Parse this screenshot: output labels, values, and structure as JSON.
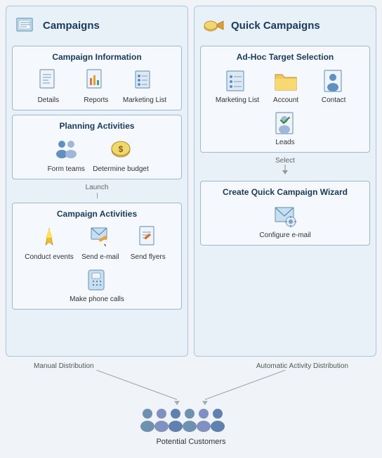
{
  "leftColumn": {
    "title": "Campaigns",
    "campaignInfo": {
      "title": "Campaign Information",
      "items": [
        {
          "label": "Details",
          "icon": "document"
        },
        {
          "label": "Reports",
          "icon": "report"
        },
        {
          "label": "Marketing List",
          "icon": "list"
        }
      ]
    },
    "planningActivities": {
      "title": "Planning Activities",
      "items": [
        {
          "label": "Form teams",
          "icon": "teams"
        },
        {
          "label": "Determine budget",
          "icon": "budget"
        }
      ]
    },
    "launchLabel": "Launch",
    "campaignActivities": {
      "title": "Campaign Activities",
      "items": [
        {
          "label": "Conduct events",
          "icon": "events"
        },
        {
          "label": "Send e-mail",
          "icon": "email"
        },
        {
          "label": "Send flyers",
          "icon": "flyers"
        },
        {
          "label": "Make phone calls",
          "icon": "phone"
        }
      ]
    }
  },
  "rightColumn": {
    "title": "Quick Campaigns",
    "adHocTarget": {
      "title": "Ad-Hoc Target Selection",
      "items": [
        {
          "label": "Marketing List",
          "icon": "mktlist"
        },
        {
          "label": "Account",
          "icon": "account"
        },
        {
          "label": "Contact",
          "icon": "contact"
        },
        {
          "label": "Leads",
          "icon": "leads"
        }
      ]
    },
    "selectLabel": "Select",
    "createWizard": {
      "title": "Create Quick Campaign Wizard",
      "items": [
        {
          "label": "Configure e-mail",
          "icon": "configure-email"
        }
      ]
    }
  },
  "bottom": {
    "manualLabel": "Manual Distribution",
    "autoLabel": "Automatic Activity Distribution",
    "customersLabel": "Potential Customers"
  }
}
